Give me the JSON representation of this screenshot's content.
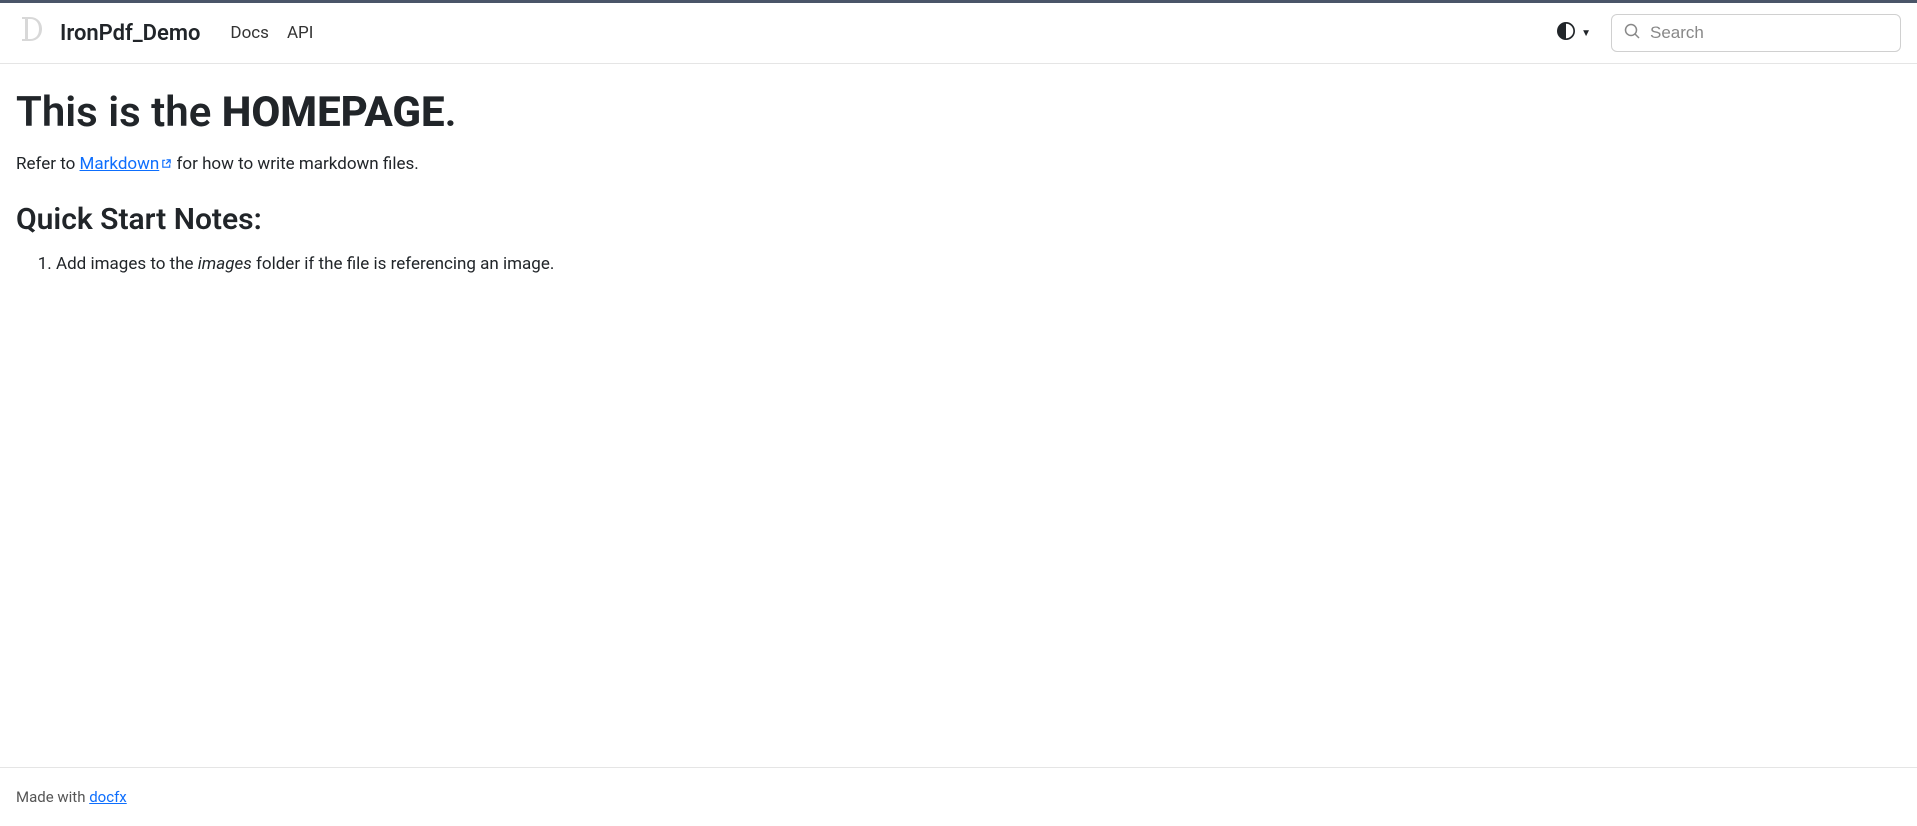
{
  "header": {
    "brand": "IronPdf_Demo",
    "nav": {
      "docs": "Docs",
      "api": "API"
    },
    "search": {
      "placeholder": "Search"
    }
  },
  "main": {
    "h1_prefix": "This is the ",
    "h1_bold": "HOMEPAGE",
    "h1_suffix": ".",
    "intro_prefix": "Refer to ",
    "intro_link": "Markdown",
    "intro_suffix": " for how to write markdown files.",
    "h2": "Quick Start Notes:",
    "list_item_prefix": "Add images to the ",
    "list_item_italic": "images",
    "list_item_suffix": " folder if the file is referencing an image."
  },
  "footer": {
    "prefix": "Made with ",
    "link": "docfx"
  }
}
